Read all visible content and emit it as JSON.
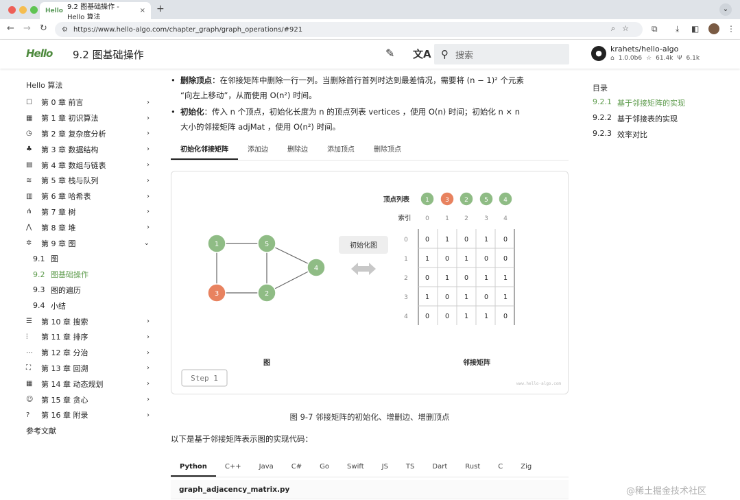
{
  "browser": {
    "tab_title": "9.2  图基础操作 - Hello 算法",
    "tab_favicon": "Hello",
    "url": "https://www.hello-algo.com/chapter_graph/graph_operations/#921",
    "new_tab": "+",
    "close": "×"
  },
  "header": {
    "logo": "Hello",
    "title": "9.2   图基础操作",
    "search_placeholder": "搜索",
    "repo_name": "krahets/hello-algo",
    "repo_version": "1.0.0b6",
    "repo_stars": "61.4k",
    "repo_forks": "6.1k"
  },
  "sidebar": {
    "title": "Hello 算法",
    "chapters": [
      {
        "icon": "book-icon",
        "glyph": "☐",
        "label": "第 0 章   前言",
        "expanded": false
      },
      {
        "icon": "calculator-icon",
        "glyph": "▦",
        "label": "第 1 章   初识算法",
        "expanded": false
      },
      {
        "icon": "timer-icon",
        "glyph": "◷",
        "label": "第 2 章   复杂度分析",
        "expanded": false
      },
      {
        "icon": "shapes-icon",
        "glyph": "♣",
        "label": "第 3 章   数据结构",
        "expanded": false
      },
      {
        "icon": "array-icon",
        "glyph": "▤",
        "label": "第 4 章   数组与链表",
        "expanded": false
      },
      {
        "icon": "stack-icon",
        "glyph": "≋",
        "label": "第 5 章   栈与队列",
        "expanded": false
      },
      {
        "icon": "hash-icon",
        "glyph": "▥",
        "label": "第 6 章   哈希表",
        "expanded": false
      },
      {
        "icon": "tree-icon",
        "glyph": "⋔",
        "label": "第 7 章   树",
        "expanded": false
      },
      {
        "icon": "heap-icon",
        "glyph": "⋀",
        "label": "第 8 章   堆",
        "expanded": false
      },
      {
        "icon": "graph-icon",
        "glyph": "✲",
        "label": "第 9 章   图",
        "expanded": true
      }
    ],
    "sub_items": [
      {
        "num": "9.1",
        "label": "图",
        "active": false
      },
      {
        "num": "9.2",
        "label": "图基础操作",
        "active": true
      },
      {
        "num": "9.3",
        "label": "图的遍历",
        "active": false
      },
      {
        "num": "9.4",
        "label": "小结",
        "active": false
      }
    ],
    "chapters_after": [
      {
        "icon": "search-list-icon",
        "glyph": "☰",
        "label": "第 10 章   搜索"
      },
      {
        "icon": "sort-icon",
        "glyph": "⫶",
        "label": "第 11 章   排序"
      },
      {
        "icon": "divide-icon",
        "glyph": "⋯",
        "label": "第 12 章   分治"
      },
      {
        "icon": "backtrack-icon",
        "glyph": "⛶",
        "label": "第 13 章   回溯"
      },
      {
        "icon": "table-icon",
        "glyph": "▦",
        "label": "第 14 章   动态规划"
      },
      {
        "icon": "greedy-icon",
        "glyph": "☺",
        "label": "第 15 章   贪心"
      },
      {
        "icon": "help-icon",
        "glyph": "?",
        "label": "第 16 章   附录"
      }
    ],
    "references": "参考文献"
  },
  "content": {
    "bullet1_bold": "删除顶点",
    "bullet1_text": "：在邻接矩阵中删除一行一列。当删除首行首列时达到最差情况，需要将 (n − 1)² 个元素",
    "bullet1_line2": "“向左上移动”，从而使用 O(n²) 时间。",
    "bullet2_bold": "初始化",
    "bullet2_text": "：传入 n 个顶点，初始化长度为 n 的顶点列表 vertices ，使用 O(n) 时间；初始化 n × n",
    "bullet2_line2": "大小的邻接矩阵 adjMat ，使用 O(n²) 时间。",
    "tabs": [
      "初始化邻接矩阵",
      "添加边",
      "删除边",
      "添加顶点",
      "删除顶点"
    ],
    "active_tab": 0,
    "figure": {
      "graph_label": "图",
      "matrix_label": "邻接矩阵",
      "button_label": "初始化图",
      "vertex_list_label": "顶点列表",
      "index_label": "索引",
      "step_label": "Step 1",
      "site": "www.hello-algo.com",
      "vertices": [
        "1",
        "3",
        "2",
        "5",
        "4"
      ],
      "vertex_colors": [
        "#8fbc85",
        "#e8825f",
        "#8fbc85",
        "#8fbc85",
        "#8fbc85"
      ],
      "indices": [
        "0",
        "1",
        "2",
        "3",
        "4"
      ],
      "matrix": [
        [
          "0",
          "1",
          "0",
          "1",
          "0"
        ],
        [
          "1",
          "0",
          "1",
          "0",
          "0"
        ],
        [
          "0",
          "1",
          "0",
          "1",
          "1"
        ],
        [
          "1",
          "0",
          "1",
          "0",
          "1"
        ],
        [
          "0",
          "0",
          "1",
          "1",
          "0"
        ]
      ],
      "graph_nodes": [
        "1",
        "5",
        "4",
        "3",
        "2"
      ]
    },
    "caption": "图 9-7   邻接矩阵的初始化、增删边、增删顶点",
    "code_intro": "以下是基于邻接矩阵表示图的实现代码：",
    "code_tabs": [
      "Python",
      "C++",
      "Java",
      "C#",
      "Go",
      "Swift",
      "JS",
      "TS",
      "Dart",
      "Rust",
      "C",
      "Zig"
    ],
    "code_file": "graph_adjacency_matrix.py"
  },
  "toc": {
    "title": "目录",
    "items": [
      {
        "num": "9.2.1",
        "label": "基于邻接矩阵的实现",
        "active": true
      },
      {
        "num": "9.2.2",
        "label": "基于邻接表的实现",
        "active": false
      },
      {
        "num": "9.2.3",
        "label": "效率对比",
        "active": false
      }
    ]
  },
  "watermark": "@稀土掘金技术社区",
  "colors": {
    "accent": "#5d9b4c",
    "node_green": "#8fbc85",
    "node_orange": "#e8825f"
  }
}
